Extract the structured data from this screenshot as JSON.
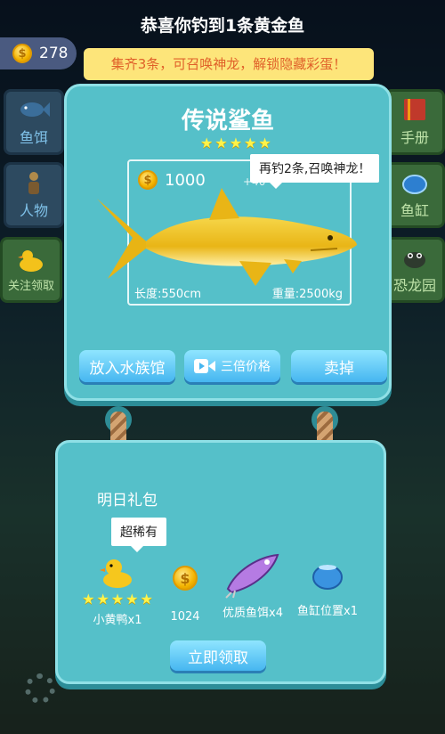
{
  "header": {
    "title": "恭喜你钓到1条黄金鱼"
  },
  "coins": {
    "amount": "278",
    "icon": "coin-icon",
    "glyph": "$"
  },
  "notice": {
    "text": "集齐3条，可召唤神龙，解锁隐藏彩蛋！"
  },
  "side_menu": {
    "left": [
      {
        "label": "鱼饵",
        "icon": "fish-icon"
      },
      {
        "label": "人物",
        "icon": "person-icon"
      },
      {
        "label": "关注领取",
        "icon": "duck-icon"
      }
    ],
    "right": [
      {
        "label": "手册",
        "icon": "book-icon"
      },
      {
        "label": "鱼缸",
        "icon": "fishbowl-icon"
      },
      {
        "label": "恐龙园",
        "icon": "dinosaur-icon"
      }
    ]
  },
  "catch": {
    "name": "传说鲨鱼",
    "stars": 5,
    "star_glyph": "★",
    "price": "1000",
    "price_bonus": "+40",
    "length": "长度:550cm",
    "weight": "重量:2500kg",
    "tooltip": "再钓2条,召唤神龙！",
    "colors": {
      "fish": "#f2c21b",
      "card": "#55c0c9"
    }
  },
  "actions": {
    "aquarium": "放入水族馆",
    "triple": "三倍价格",
    "sell": "卖掉"
  },
  "gift": {
    "title": "明日礼包",
    "badge": "超稀有",
    "items": [
      {
        "label": "小黄鸭x1",
        "icon": "rubber-duck-icon",
        "stars": 5
      },
      {
        "label": "1024",
        "icon": "coin-icon"
      },
      {
        "label": "优质鱼饵x4",
        "icon": "lure-icon"
      },
      {
        "label": "鱼缸位置x1",
        "icon": "fishbowl-icon"
      }
    ],
    "claim": "立即领取"
  }
}
